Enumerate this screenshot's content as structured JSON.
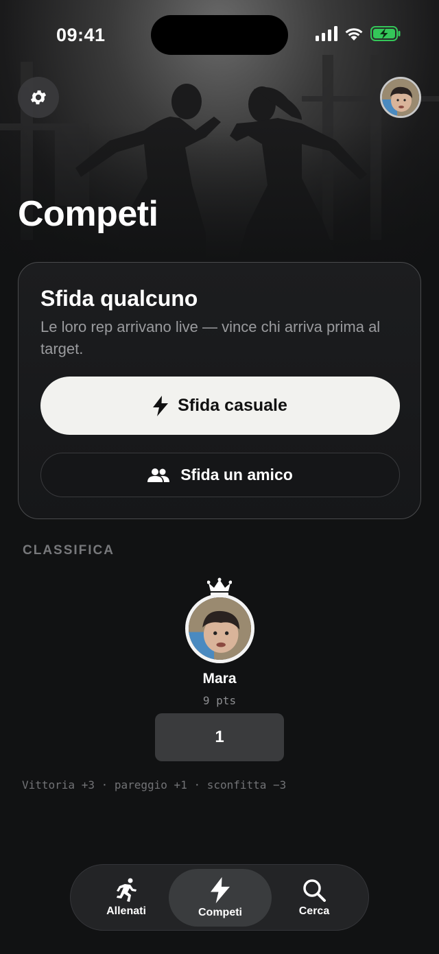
{
  "status_bar": {
    "time": "09:41"
  },
  "page": {
    "title": "Competi"
  },
  "challenge_card": {
    "title": "Sfida qualcuno",
    "subtitle": "Le loro rep arrivano live — vince chi arriva prima al target.",
    "random_button": "Sfida casuale",
    "friend_button": "Sfida un amico"
  },
  "leaderboard": {
    "section_label": "CLASSIFICA",
    "entries": [
      {
        "name": "Mara",
        "points": "9 pts",
        "rank": "1"
      }
    ],
    "rules": "Vittoria +3 · pareggio +1 · sconfitta −3"
  },
  "tabbar": {
    "items": [
      {
        "label": "Allenati",
        "icon": "running-icon",
        "active": false
      },
      {
        "label": "Competi",
        "icon": "bolt-icon",
        "active": true
      },
      {
        "label": "Cerca",
        "icon": "search-icon",
        "active": false
      }
    ]
  },
  "colors": {
    "background": "#111213",
    "card_border": "#4a4b4d",
    "primary_button": "#f2f2ef",
    "battery": "#34c759"
  }
}
